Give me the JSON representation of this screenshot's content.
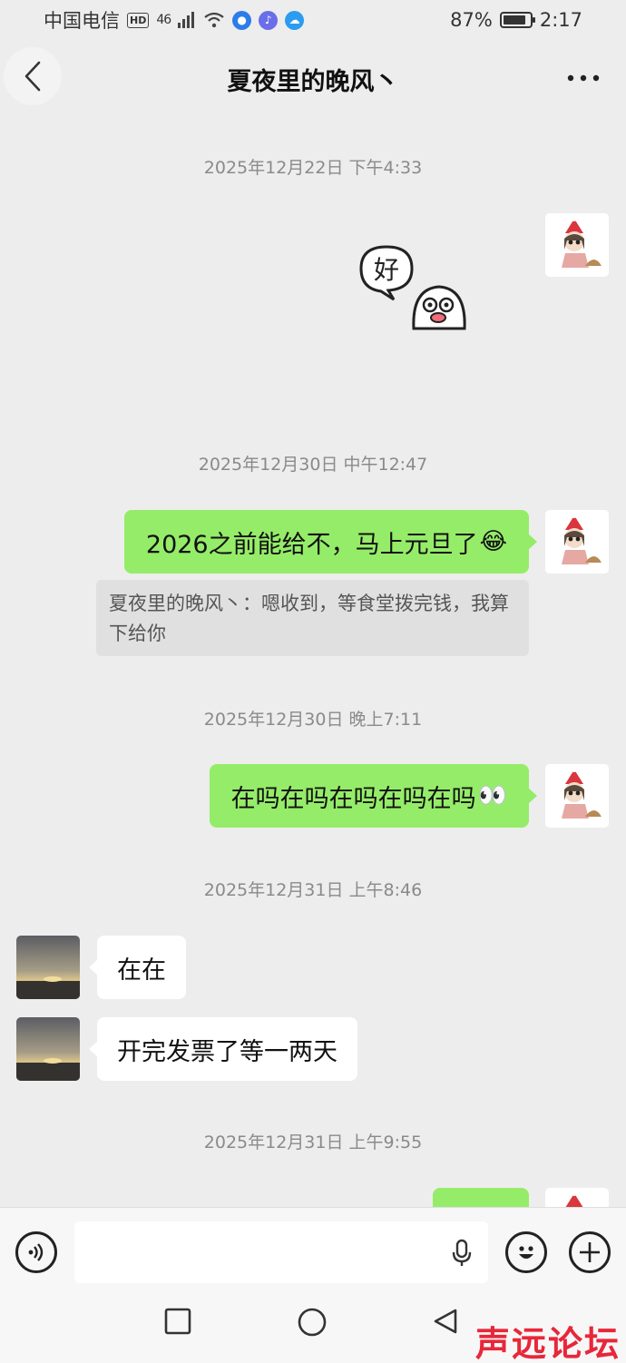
{
  "status_bar": {
    "carrier": "中国电信",
    "hd_badge": "HD",
    "network": "46",
    "battery_percent": "87%",
    "battery_level": 0.87,
    "time": "2:17"
  },
  "nav": {
    "title": "夏夜里的晚风丶"
  },
  "messages": {
    "t1": "2025年12月22日 下午4:33",
    "sticker_text": "好",
    "t2": "2025年12月30日 中午12:47",
    "m1_text": "2026之前能给不，马上元旦了",
    "m1_emoji": "😂",
    "quote_text": "夏夜里的晚风丶：嗯收到，等食堂拨完钱，我算下给你",
    "t3": "2025年12月30日 晚上7:11",
    "m2_text": "在吗在吗在吗在吗在吗",
    "m2_emoji": "👀",
    "t4": "2025年12月31日 上午8:46",
    "m3_text": "在在",
    "m4_text": "开完发票了等一两天",
    "t5": "2025年12月31日 上午9:55"
  },
  "input": {
    "value": "",
    "placeholder": ""
  },
  "watermark": {
    "text": "声远论坛"
  },
  "colors": {
    "background": "#ededed",
    "my_bubble": "#95ec69",
    "their_bubble": "#ffffff",
    "timestamp": "#8a8a8a"
  },
  "icons": [
    "back-arrow-icon",
    "more-icon",
    "voice-icon",
    "microphone-icon",
    "emoji-icon",
    "plus-icon",
    "wifi-icon",
    "signal-icon",
    "battery-icon",
    "nav-square-icon",
    "nav-circle-icon",
    "nav-back-icon"
  ]
}
